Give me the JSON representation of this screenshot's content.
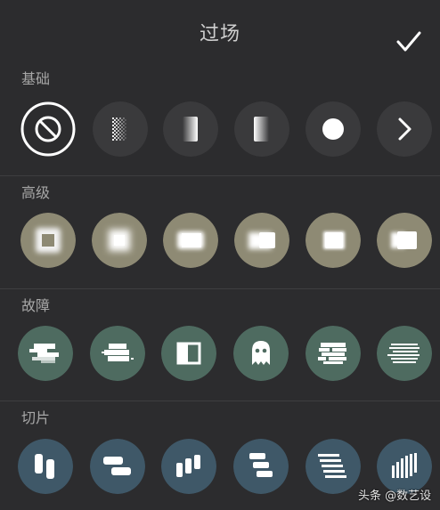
{
  "header": {
    "title": "过场",
    "confirm_icon": "check-icon"
  },
  "sections": [
    {
      "label": "基础",
      "color": "#3a3a3c",
      "items": [
        "none-icon",
        "checker-dissolve-icon",
        "fade-left-icon",
        "fade-right-icon",
        "dot-icon",
        "next-chevron-icon"
      ]
    },
    {
      "label": "高级",
      "color": "#8e8a74",
      "items": [
        "blur-square-icon",
        "blur-glow-icon",
        "blur-smear-icon",
        "blur-smear-right-icon",
        "blur-edge-icon",
        "blur-edge-left-icon"
      ]
    },
    {
      "label": "故障",
      "color": "#4e6b60",
      "items": [
        "glitch-shift-icon",
        "glitch-block-icon",
        "split-panel-icon",
        "ghost-icon",
        "glitch-scramble-icon",
        "glitch-lines-icon"
      ]
    },
    {
      "label": "切片",
      "color": "#3f5868",
      "items": [
        "slice-vertical-icon",
        "slice-horizontal-icon",
        "slice-bars-icon",
        "slice-steps-icon",
        "slice-stripes-icon",
        "slice-diagonal-icon"
      ]
    }
  ],
  "watermark": "头条 @数艺设"
}
